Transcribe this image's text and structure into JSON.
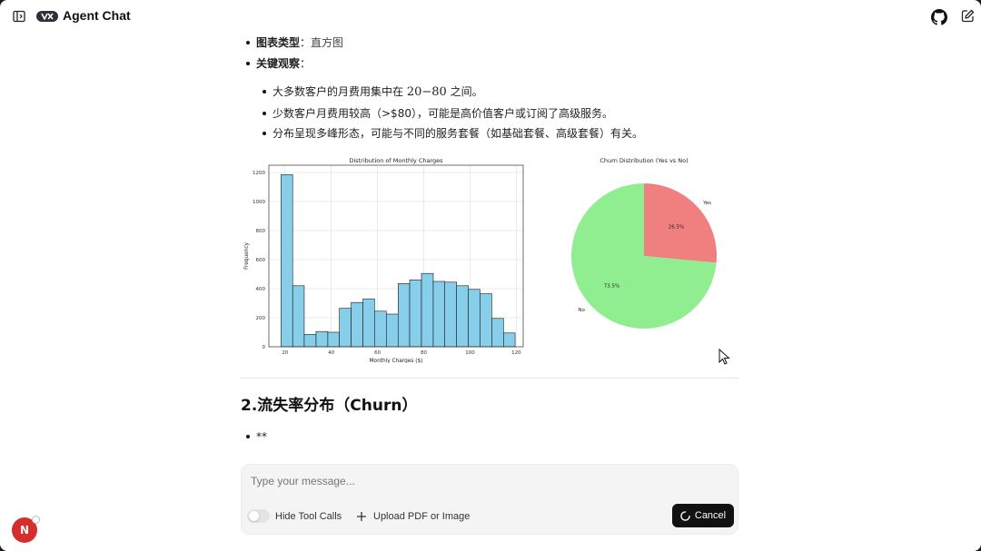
{
  "app": {
    "title": "Agent Chat"
  },
  "message": {
    "bullets": [
      {
        "label": "图表类型",
        "sep": "：",
        "value": "直方图"
      },
      {
        "label": "关键观察",
        "sep": "：",
        "value": ""
      }
    ],
    "sub_bullets": [
      {
        "pre": "大多数客户的月费用集中在 ",
        "math": "20−80",
        "post": " 之间。"
      },
      {
        "pre": "少数客户月费用较高（>$80），可能是高价值客户或订阅了高级服务。",
        "math": "",
        "post": ""
      },
      {
        "pre": "分布呈现多峰形态，可能与不同的服务套餐（如基础套餐、高级套餐）有关。",
        "math": "",
        "post": ""
      }
    ],
    "section_heading": "2.流失率分布（Churn）",
    "trailing_bullet": "**"
  },
  "chart_data": [
    {
      "type": "bar",
      "title": "Distribution of Monthly Charges",
      "xlabel": "Monthly Charges ($)",
      "ylabel": "Frequency",
      "bin_edges": [
        18.25,
        23.3,
        28.3,
        33.4,
        38.5,
        43.5,
        48.6,
        53.7,
        58.7,
        63.8,
        68.9,
        73.9,
        79.0,
        84.1,
        89.1,
        94.2,
        99.3,
        104.3,
        109.4,
        114.5,
        119.5
      ],
      "values": [
        1185,
        420,
        85,
        105,
        100,
        265,
        305,
        330,
        245,
        225,
        435,
        460,
        505,
        450,
        445,
        420,
        395,
        365,
        195,
        95
      ],
      "xticks": [
        20,
        40,
        60,
        80,
        100,
        120
      ],
      "yticks": [
        0,
        200,
        400,
        600,
        800,
        1000,
        1200
      ],
      "xlim": [
        13,
        123
      ],
      "ylim": [
        0,
        1250
      ],
      "grid": true,
      "bar_color": "#87CEEB"
    },
    {
      "type": "pie",
      "title": "Churn Distribution (Yes vs No)",
      "labels": [
        "Yes",
        "No"
      ],
      "values": [
        26.5,
        73.5
      ],
      "value_labels": [
        "26.5%",
        "73.5%"
      ],
      "colors": [
        "#F08080",
        "#90EE90"
      ]
    }
  ],
  "composer": {
    "placeholder": "Type your message...",
    "hide_tool_calls_label": "Hide Tool Calls",
    "upload_label": "Upload PDF or Image",
    "cancel_label": "Cancel"
  },
  "user": {
    "avatar_initial": "N"
  },
  "icons": [
    "sidebar-toggle-icon",
    "agent-logo-icon",
    "github-icon",
    "new-chat-icon",
    "plus-icon",
    "spinner-icon",
    "mouse-cursor-icon"
  ]
}
